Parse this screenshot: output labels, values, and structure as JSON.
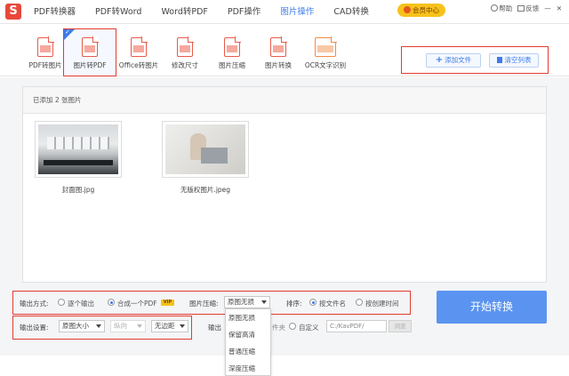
{
  "app": {
    "logo_letter": "S",
    "nav": [
      {
        "label": "PDF转换器"
      },
      {
        "label": "PDF转Word"
      },
      {
        "label": "Word转PDF"
      },
      {
        "label": "PDF操作"
      },
      {
        "label": "图片操作",
        "active": true
      },
      {
        "label": "CAD转换"
      }
    ],
    "vip_label": "会员中心",
    "help_label": "帮助",
    "feedback_label": "反馈",
    "window_controls": [
      "—",
      "✕"
    ]
  },
  "toolbar": {
    "tools": [
      {
        "label": "PDF转图片",
        "icon": "pdf-to-image-icon"
      },
      {
        "label": "图片转PDF",
        "icon": "image-to-pdf-icon",
        "active": true
      },
      {
        "label": "Office转图片",
        "icon": "office-to-image-icon"
      },
      {
        "label": "修改尺寸",
        "icon": "resize-icon"
      },
      {
        "label": "图片压缩",
        "icon": "compress-icon"
      },
      {
        "label": "图片转换",
        "icon": "image-convert-icon"
      },
      {
        "label": "OCR文字识别",
        "icon": "ocr-icon"
      }
    ],
    "add_file_label": "添加文件",
    "clear_list_label": "清空列表"
  },
  "panel": {
    "header": "已添加 2 张图片",
    "files": [
      {
        "name": "封面图.jpg"
      },
      {
        "name": "无版权图片.jpeg"
      }
    ]
  },
  "settings": {
    "output_mode_label": "输出方式:",
    "mode_each": "逐个输出",
    "mode_merge": "合成一个PDF",
    "vip_badge": "VIP",
    "compress_label": "图片压缩:",
    "compress_value": "原图无损",
    "sort_label": "排序:",
    "sort_by_name": "按文件名",
    "sort_by_time": "按创建时间",
    "output_settings_label": "输出设置:",
    "size_value": "原图大小",
    "orientation_value": "纵向",
    "margin_value": "无边距",
    "output_dir_label_part": "输出",
    "folder_suffix": "件夹",
    "custom_label": "自定义",
    "path_value": "C:/KavPDF/",
    "browse_label": "浏览",
    "start_button": "开始转换"
  },
  "dropdown": {
    "options": [
      "原图无损",
      "保留高清",
      "普通压缩",
      "深度压缩"
    ]
  },
  "colors": {
    "accent": "#3d7bea",
    "highlight_border": "#e23b30",
    "start_button": "#5b94f0",
    "vip": "#f7c21c"
  }
}
